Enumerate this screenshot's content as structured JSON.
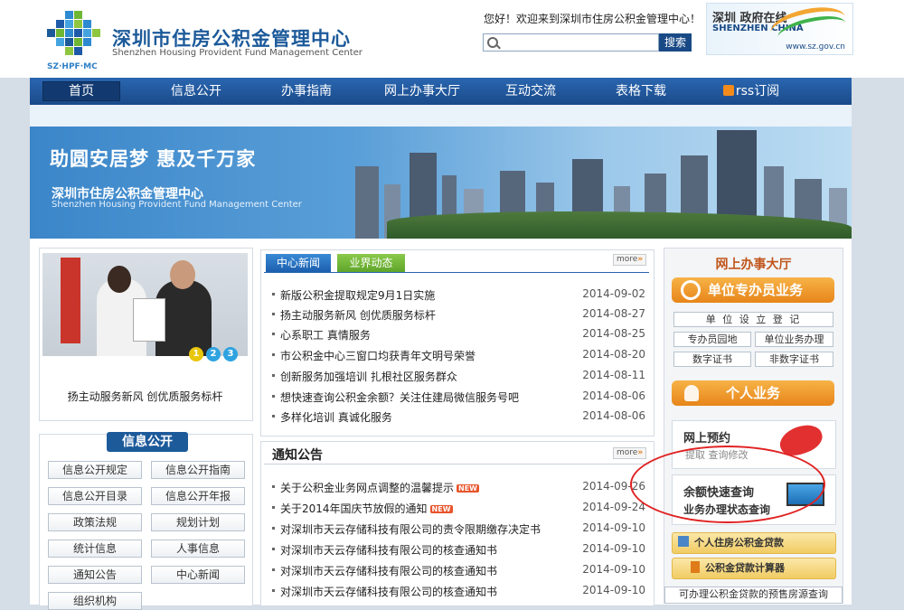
{
  "header": {
    "site_title": "深圳市住房公积金管理中心",
    "site_subtitle": "Shenzhen Housing Provident Fund Management Center",
    "logo_caption": "SZ·HPF·MC",
    "welcome": "您好！欢迎来到深圳市住房公积金管理中心！",
    "search_placeholder": "",
    "search_label": "搜索",
    "sz_logo": {
      "cn": "深圳 政府在线",
      "en": "SHENZHEN CHINA",
      "url": "www.sz.gov.cn"
    }
  },
  "nav": {
    "items": [
      "首页",
      "信息公开",
      "办事指南",
      "网上办事大厅",
      "互动交流",
      "表格下载",
      "rss订阅"
    ]
  },
  "banner": {
    "slogan": "助圆安居梦 惠及千万家",
    "title": "深圳市住房公积金管理中心",
    "subtitle": "Shenzhen Housing Provident Fund Management Center"
  },
  "feature": {
    "caption": "扬主动服务新风 创优质服务标杆",
    "dots": [
      "1",
      "2",
      "3"
    ]
  },
  "info_panel": {
    "title": "信息公开",
    "buttons": [
      "信息公开规定",
      "信息公开指南",
      "信息公开目录",
      "信息公开年报",
      "政策法规",
      "规划计划",
      "统计信息",
      "人事信息",
      "通知公告",
      "中心新闻",
      "组织机构"
    ]
  },
  "news": {
    "tabs": [
      "中心新闻",
      "业界动态"
    ],
    "more": "more",
    "items": [
      {
        "title": "新版公积金提取规定9月1日实施",
        "date": "2014-09-02"
      },
      {
        "title": "扬主动服务新风 创优质服务标杆",
        "date": "2014-08-27"
      },
      {
        "title": "心系职工 真情服务",
        "date": "2014-08-25"
      },
      {
        "title": "市公积金中心三窗口均获青年文明号荣誉",
        "date": "2014-08-20"
      },
      {
        "title": "创新服务加强培训 扎根社区服务群众",
        "date": "2014-08-11"
      },
      {
        "title": "想快速查询公积金余额？关注住建局微信服务号吧",
        "date": "2014-08-06"
      },
      {
        "title": "多样化培训 真诚化服务",
        "date": "2014-08-06"
      }
    ]
  },
  "notices": {
    "title": "通知公告",
    "more": "more",
    "new_label": "NEW",
    "items": [
      {
        "title": "关于公积金业务网点调整的温馨提示",
        "date": "2014-09-26"
      },
      {
        "title": "关于2014年国庆节放假的通知",
        "date": "2014-09-24"
      },
      {
        "title": "对深圳市天云存储科技有限公司的责令限期缴存决定书",
        "date": "2014-09-10"
      },
      {
        "title": "对深圳市天云存储科技有限公司的核查通知书",
        "date": "2014-09-10"
      },
      {
        "title": "对深圳市天云存储科技有限公司的核查通知书",
        "date": "2014-09-10"
      },
      {
        "title": "对深圳市天云存储科技有限公司的核查通知书",
        "date": "2014-09-10"
      }
    ]
  },
  "online_hall": {
    "title": "网上办事大厅",
    "unit_bar": "单位专办员业务",
    "unit_register": "单 位 设 立 登 记",
    "unit_buttons": [
      "专办员园地",
      "单位业务办理",
      "数字证书",
      "非数字证书"
    ],
    "personal_bar": "个人业务",
    "booking": {
      "title": "网上预约",
      "sub": "提取   查询修改"
    },
    "query": {
      "line1": "余额快速查询",
      "line2": "业务办理状态查询"
    },
    "bottom1": "个人住房公积金贷款",
    "bottom2": "公积金贷款计算器",
    "bottom3": "可办理公积金贷款的预售房源查询"
  },
  "colors": {
    "nav": "#1a4a8a",
    "accent_blue": "#2a66b0",
    "tab_green": "#6fb733",
    "orange": "#e7851a",
    "red_mark": "#e02222"
  }
}
